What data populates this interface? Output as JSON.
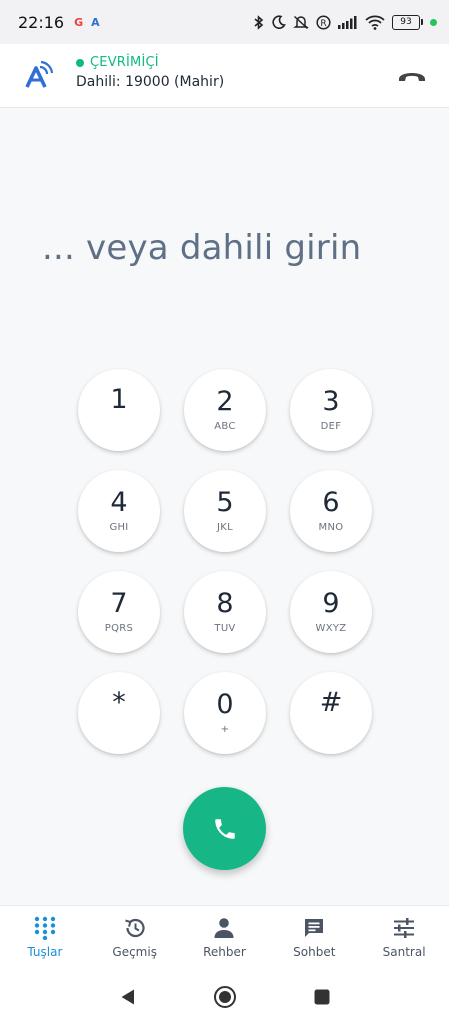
{
  "status_bar": {
    "time": "22:16",
    "mini_icon_1": "G",
    "mini_icon_2": "A",
    "battery_level": "93",
    "icons": [
      "bluetooth-icon",
      "moon-icon",
      "mute-icon",
      "roaming-icon",
      "signal-icon",
      "wifi-icon",
      "battery-icon"
    ]
  },
  "header": {
    "status": "ÇEVRİMİÇİ",
    "extension": "Dahili: 19000 (Mahir)",
    "status_color": "#10b981",
    "logo_icon": "app-logo-icon",
    "hangup_icon": "hangup-icon"
  },
  "number_display": {
    "placeholder": "... veya dahili girin"
  },
  "dialpad": {
    "keys": [
      {
        "digit": "1",
        "letters": ""
      },
      {
        "digit": "2",
        "letters": "ABC"
      },
      {
        "digit": "3",
        "letters": "DEF"
      },
      {
        "digit": "4",
        "letters": "GHI"
      },
      {
        "digit": "5",
        "letters": "JKL"
      },
      {
        "digit": "6",
        "letters": "MNO"
      },
      {
        "digit": "7",
        "letters": "PQRS"
      },
      {
        "digit": "8",
        "letters": "TUV"
      },
      {
        "digit": "9",
        "letters": "WXYZ"
      },
      {
        "digit": "*",
        "letters": ""
      },
      {
        "digit": "0",
        "letters": "+"
      },
      {
        "digit": "#",
        "letters": ""
      }
    ]
  },
  "call_button": {
    "color": "#17b686",
    "icon": "phone-icon"
  },
  "bottom_nav": {
    "active_color": "#1b8fd8",
    "items": [
      {
        "label": "Tuşlar",
        "icon": "dialpad-icon",
        "active": true
      },
      {
        "label": "Geçmiş",
        "icon": "history-icon",
        "active": false
      },
      {
        "label": "Rehber",
        "icon": "person-icon",
        "active": false
      },
      {
        "label": "Sohbet",
        "icon": "chat-icon",
        "active": false
      },
      {
        "label": "Santral",
        "icon": "sliders-icon",
        "active": false
      }
    ]
  },
  "system_nav": {
    "icons": [
      "back-icon",
      "home-icon",
      "recents-icon"
    ]
  }
}
